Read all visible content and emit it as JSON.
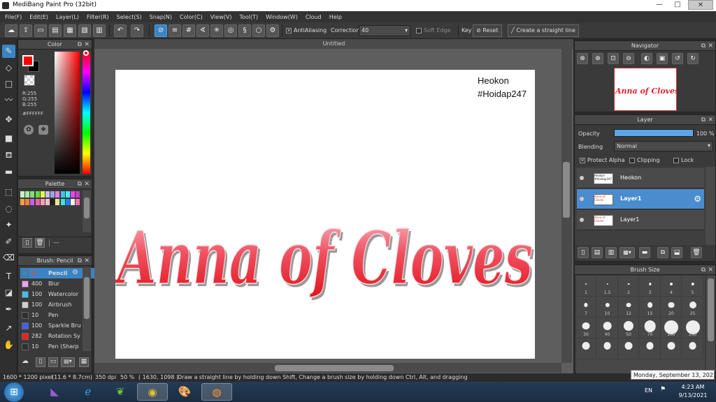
{
  "window": {
    "title": "MediBang Paint Pro (32bit)",
    "min": "—",
    "max": "□",
    "close": "✕"
  },
  "menu": [
    "File(F)",
    "Edit(E)",
    "Layer(L)",
    "Filter(R)",
    "Select(S)",
    "Snap(N)",
    "Color(C)",
    "View(V)",
    "Tool(T)",
    "Window(W)",
    "Cloud",
    "Help"
  ],
  "toolbar": {
    "antialiasing_label": "AntiAliasing",
    "correction_label": "Correction",
    "correction_value": "40",
    "soft_edge_label": "Soft Edge",
    "key_label": "Key",
    "reset_label": "Reset",
    "straight_line_label": "Create a straight line"
  },
  "color_panel": {
    "title": "Color",
    "r": "R:255",
    "g": "G:255",
    "b": "B:255",
    "hex": "#FFFFFF",
    "primary": "#ff0000",
    "secondary": "#000000"
  },
  "palette_panel": {
    "title": "Palette",
    "swatches": [
      "#c8f0c8",
      "#a8e8a8",
      "#88e070",
      "#60e040",
      "#f0f050",
      "#c0c0f0",
      "#a0a0e0",
      "#e080e0",
      "#40c0f0",
      "#40f0f0",
      "#f040f0",
      "#c040c0",
      "#f0a040",
      "#f08040",
      "#c060f0",
      "#f060a0",
      "#f0a0c0",
      "#f0c0c0",
      "#202020",
      "#f0e0a0",
      "#40e0e0",
      "#2080f0",
      "#f0f0f0",
      "#f070b0"
    ],
    "field_value": "---"
  },
  "brush_panel": {
    "title": "Brush: Pencil",
    "brushes": [
      {
        "size": "4",
        "name": "Pencil",
        "color": "#3b84c4"
      },
      {
        "size": "400",
        "name": "Blur",
        "color": "#f0a0f0"
      },
      {
        "size": "100",
        "name": "Watercolor",
        "color": "#40c0f0"
      },
      {
        "size": "100",
        "name": "Airbrush",
        "color": "#d0d0d0"
      },
      {
        "size": "10",
        "name": "Pen",
        "color": "#303030"
      },
      {
        "size": "100",
        "name": "Sparkle Bru",
        "color": "#4060f0"
      },
      {
        "size": "282",
        "name": "Rotation Sy",
        "color": "#f02020"
      },
      {
        "size": "10",
        "name": "Pen (Sharp",
        "color": "#303030"
      }
    ]
  },
  "canvas": {
    "tab_title": "Untitled",
    "credit_line1": "Heokon",
    "credit_line2": "#Hoidap247",
    "artwork_text": "Anna of Cloves"
  },
  "navigator": {
    "title": "Navigator",
    "thumb_text": "Anna of Cloves"
  },
  "layer_panel": {
    "title": "Layer",
    "opacity_label": "Opacity",
    "opacity_value": "100 %",
    "opacity_fraction": 1.0,
    "blending_label": "Blending",
    "blending_value": "Normal",
    "protect_alpha_label": "Protect Alpha",
    "clipping_label": "Clipping",
    "lock_label": "Lock",
    "layers": [
      {
        "name": "Heokon",
        "thumb": "Heokon #Hoidap247",
        "selected": false
      },
      {
        "name": "Layer1",
        "thumb": "Anna of Cloves",
        "selected": true
      },
      {
        "name": "Layer1",
        "thumb": "Anna of Cloves",
        "selected": false
      }
    ]
  },
  "brush_size_panel": {
    "title": "Brush Size",
    "sizes": [
      "1",
      "1.5",
      "2",
      "3",
      "4",
      "5",
      "7",
      "10",
      "12",
      "15",
      "20",
      "25",
      "30",
      "40",
      "50",
      "70",
      "100",
      "150",
      "",
      "",
      "",
      "",
      "",
      ""
    ]
  },
  "status": {
    "dimensions": "1600 * 1200 pixel",
    "physical": "(11.6 * 8.7cm)",
    "dpi": "350 dpi",
    "zoom": "50 %",
    "cursor": "( 1630, 1098 )",
    "hint": "Draw a straight line by holding down Shift, Change a brush size by holding down Ctrl, Alt, and dragging"
  },
  "tooltip": "Monday, September 13, 2021",
  "taskbar": {
    "lang": "EN",
    "time": "4:23 AM",
    "date": "9/13/2021"
  }
}
